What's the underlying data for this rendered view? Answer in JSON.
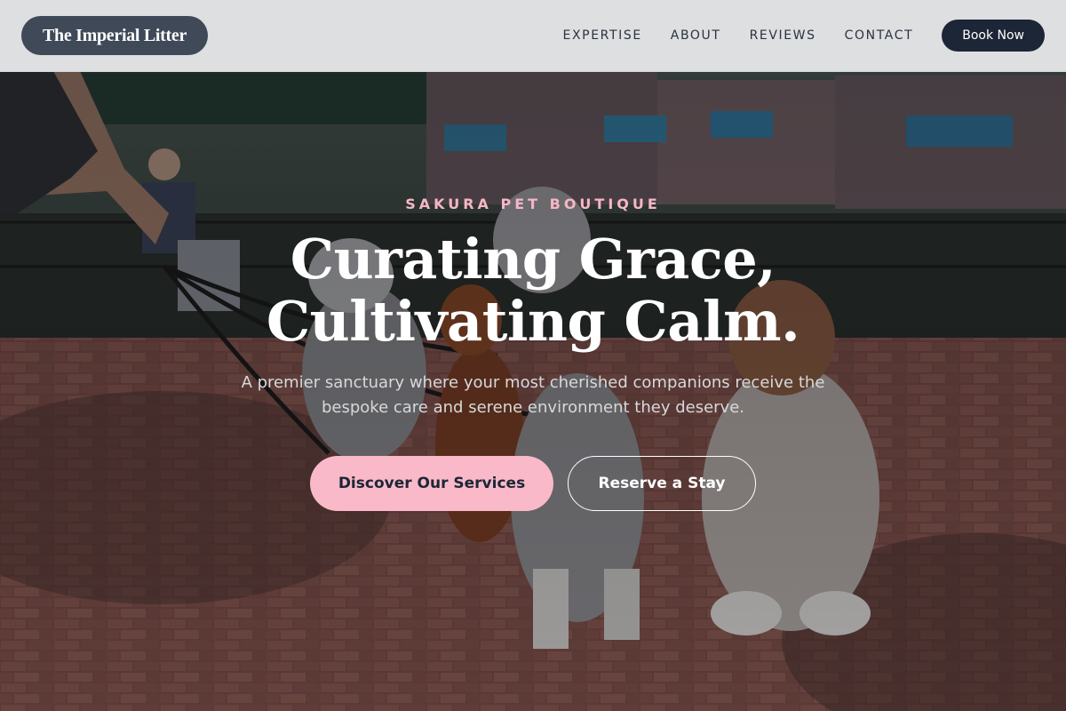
{
  "header": {
    "logo_text": "The Imperial Litter",
    "nav": [
      "EXPERTISE",
      "ABOUT",
      "REVIEWS",
      "CONTACT"
    ],
    "book_button": "Book Now"
  },
  "hero": {
    "eyebrow": "SAKURA PET BOUTIQUE",
    "headline_line1": "Curating Grace,",
    "headline_line2": "Cultivating Calm.",
    "subtitle": "A premier sanctuary where your most cherished companions receive the bespoke care and serene environment they deserve.",
    "primary_cta": "Discover Our Services",
    "secondary_cta": "Reserve a Stay"
  },
  "colors": {
    "accent_pink": "#f9b9c8",
    "navy": "#1d2636",
    "logo_bg": "#3f4958"
  }
}
